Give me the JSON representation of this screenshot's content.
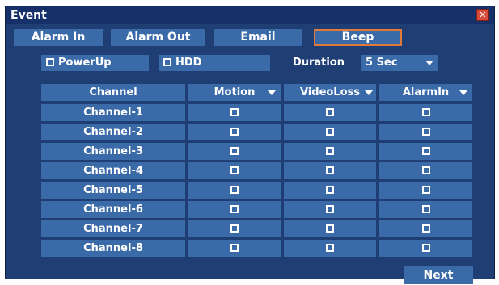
{
  "window": {
    "title": "Event"
  },
  "tabs": [
    {
      "label": "Alarm In"
    },
    {
      "label": "Alarm Out"
    },
    {
      "label": "Email"
    },
    {
      "label": "Beep",
      "active": true
    }
  ],
  "options": {
    "powerup_label": "PowerUp",
    "hdd_label": "HDD",
    "duration_label": "Duration",
    "duration_value": "5 Sec"
  },
  "table": {
    "headers": {
      "channel": "Channel",
      "motion": "Motion",
      "videoloss": "VideoLoss",
      "alarmin": "AlarmIn"
    },
    "rows": [
      {
        "channel": "Channel-1"
      },
      {
        "channel": "Channel-2"
      },
      {
        "channel": "Channel-3"
      },
      {
        "channel": "Channel-4"
      },
      {
        "channel": "Channel-5"
      },
      {
        "channel": "Channel-6"
      },
      {
        "channel": "Channel-7"
      },
      {
        "channel": "Channel-8"
      }
    ]
  },
  "footer": {
    "next_label": "Next"
  },
  "colors": {
    "panel": "#1f3e74",
    "button": "#3a6aa8",
    "active_border": "#e07a3a",
    "close": "#d94a3a"
  }
}
